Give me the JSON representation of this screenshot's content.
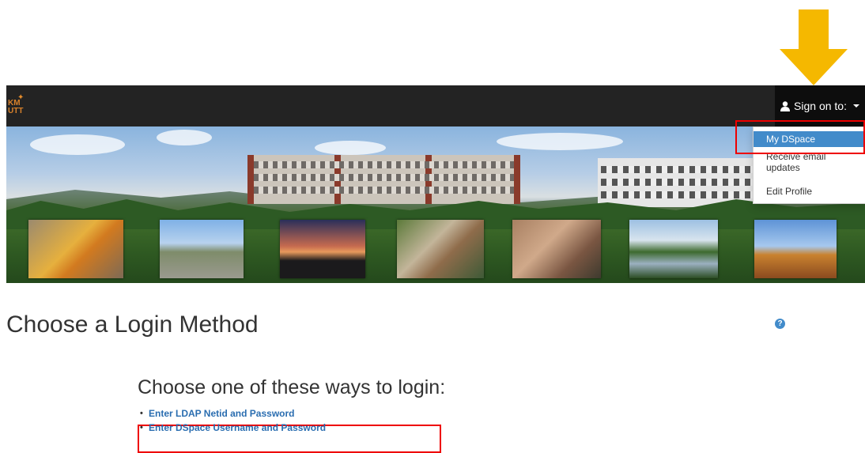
{
  "navbar": {
    "logo_top": "KM",
    "logo_bottom": "UTT",
    "signon_label": "Sign on to:"
  },
  "dropdown": {
    "items": [
      {
        "label": "My DSpace"
      },
      {
        "label": "Receive email updates"
      },
      {
        "label": "Edit Profile"
      }
    ]
  },
  "main": {
    "title": "Choose a Login Method",
    "help_icon": "?",
    "subtitle": "Choose one of these ways to login:",
    "methods": [
      {
        "label": "Enter LDAP Netid and Password"
      },
      {
        "label": "Enter DSpace Username and Password"
      }
    ]
  },
  "colors": {
    "navbar": "#232323",
    "accent": "#428bca",
    "link": "#2a6db0",
    "annotation_box": "#ee0000",
    "annotation_arrow": "#f5b800"
  }
}
